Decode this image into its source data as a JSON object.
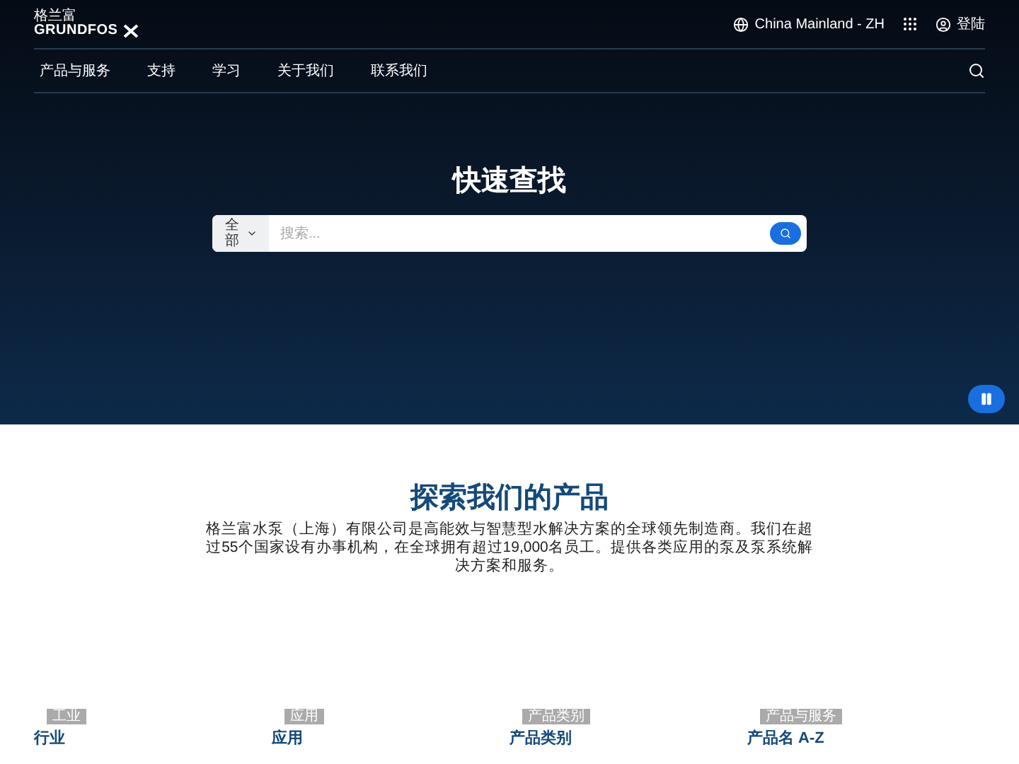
{
  "header": {
    "logo": {
      "chinese": "格兰富",
      "wordmark": "GRUNDFOS"
    },
    "region": "China Mainland - ZH",
    "login": "登陆"
  },
  "nav": {
    "items": [
      "产品与服务",
      "支持",
      "学习",
      "关于我们",
      "联系我们"
    ]
  },
  "hero": {
    "title": "快速查找",
    "search": {
      "category": "全部",
      "placeholder": "搜索..."
    },
    "pause": {
      "paused": false
    }
  },
  "products": {
    "title": "探索我们的产品",
    "description": "格兰富水泵（上海）有限公司是高能效与智慧型水解决方案的全球领先制造商。我们在超过55个国家设有办事机构，在全球拥有超过19,000名员工。提供各类应用的泵及泵系统解决方案和服务。",
    "cards": [
      {
        "tag": "工业",
        "title": "行业"
      },
      {
        "tag": "应用",
        "title": "应用"
      },
      {
        "tag": "产品类别",
        "title": "产品类别"
      },
      {
        "tag": "产品与服务",
        "title": "产品名 A-Z"
      }
    ]
  }
}
